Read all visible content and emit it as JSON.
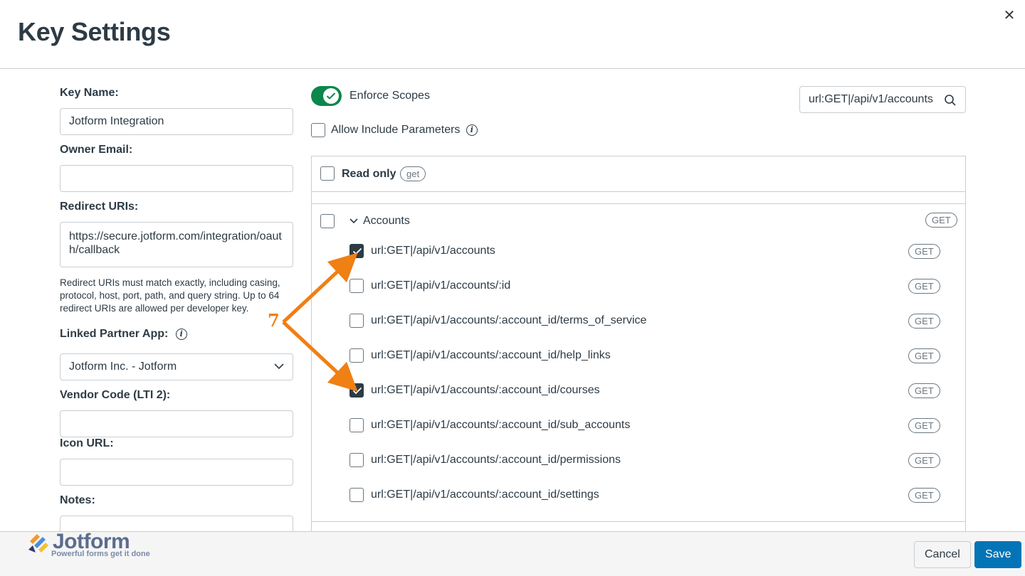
{
  "dialog": {
    "title": "Key Settings",
    "close_icon": "close-icon"
  },
  "form": {
    "key_name_label": "Key Name:",
    "key_name_value": "Jotform Integration",
    "owner_email_label": "Owner Email:",
    "owner_email_value": "",
    "redirect_uris_label": "Redirect URIs:",
    "redirect_uris_value": "https://secure.jotform.com/integration/oauth/callback",
    "redirect_help": "Redirect URIs must match exactly, including casing, protocol, host, port, path, and query string. Up to 64 redirect URIs are allowed per developer key.",
    "linked_partner_label": "Linked Partner App:",
    "linked_partner_value": "Jotform Inc. - Jotform",
    "vendor_code_label": "Vendor Code (LTI 2):",
    "vendor_code_value": "",
    "icon_url_label": "Icon URL:",
    "icon_url_value": "",
    "notes_label": "Notes:"
  },
  "scopes": {
    "enforce_label": "Enforce Scopes",
    "enforce_on": true,
    "allow_include_label": "Allow Include Parameters",
    "search_value": "url:GET|/api/v1/accounts",
    "read_only_label": "Read only",
    "read_only_pill": "get",
    "group_label": "Accounts",
    "group_pill": "GET",
    "items": [
      {
        "label": "url:GET|/api/v1/accounts",
        "method": "GET",
        "checked": true
      },
      {
        "label": "url:GET|/api/v1/accounts/:id",
        "method": "GET",
        "checked": false
      },
      {
        "label": "url:GET|/api/v1/accounts/:account_id/terms_of_service",
        "method": "GET",
        "checked": false
      },
      {
        "label": "url:GET|/api/v1/accounts/:account_id/help_links",
        "method": "GET",
        "checked": false
      },
      {
        "label": "url:GET|/api/v1/accounts/:account_id/courses",
        "method": "GET",
        "checked": true
      },
      {
        "label": "url:GET|/api/v1/accounts/:account_id/sub_accounts",
        "method": "GET",
        "checked": false
      },
      {
        "label": "url:GET|/api/v1/accounts/:account_id/permissions",
        "method": "GET",
        "checked": false
      },
      {
        "label": "url:GET|/api/v1/accounts/:account_id/settings",
        "method": "GET",
        "checked": false
      }
    ]
  },
  "footer": {
    "cancel_label": "Cancel",
    "save_label": "Save",
    "logo_text": "Jotform",
    "logo_tagline": "Powerful forms get it done"
  },
  "annotation": {
    "step_number": "7"
  },
  "colors": {
    "toggle_on": "#0b874b",
    "primary_button": "#0374b5",
    "text": "#2d3b45",
    "annotation": "#f07f14"
  }
}
